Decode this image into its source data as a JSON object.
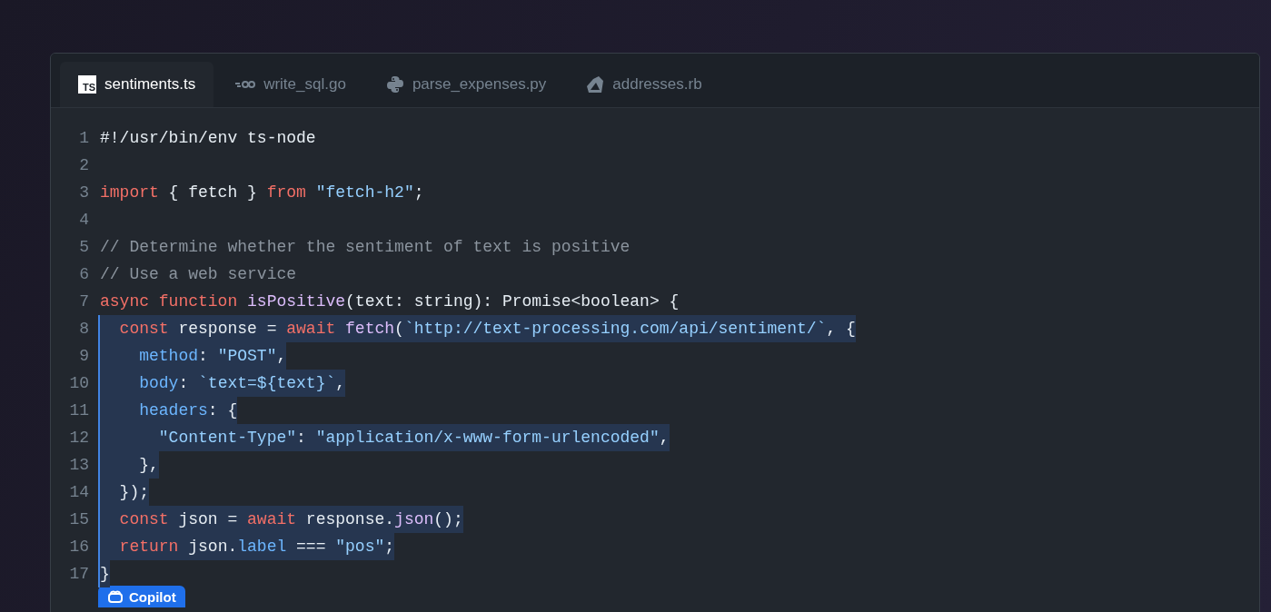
{
  "tabs": [
    {
      "label": "sentiments.ts",
      "kind": "ts",
      "icon_text": "TS",
      "selected": true
    },
    {
      "label": "write_sql.go",
      "kind": "go",
      "selected": false
    },
    {
      "label": "parse_expenses.py",
      "kind": "python",
      "selected": false
    },
    {
      "label": "addresses.rb",
      "kind": "ruby",
      "selected": false
    }
  ],
  "code": [
    {
      "number": "1",
      "suggested": false,
      "tokens": [
        {
          "kind": "plain",
          "text": "#!/usr/bin/env ts-node"
        }
      ]
    },
    {
      "number": "2",
      "suggested": false
    },
    {
      "number": "3",
      "suggested": false,
      "tokens": [
        {
          "kind": "keyword",
          "text": "import"
        },
        {
          "kind": "plain",
          "text": " { fetch } "
        },
        {
          "kind": "keyword",
          "text": "from"
        },
        {
          "kind": "string",
          "text": " \"fetch-h2\""
        },
        {
          "kind": "plain",
          "text": ";"
        }
      ]
    },
    {
      "number": "4",
      "suggested": false
    },
    {
      "number": "5",
      "suggested": false,
      "tokens": [
        {
          "kind": "comment",
          "text": "// Determine whether the sentiment of text is positive"
        }
      ]
    },
    {
      "number": "6",
      "suggested": false,
      "tokens": [
        {
          "kind": "comment",
          "text": "// Use a web service"
        }
      ]
    },
    {
      "number": "7",
      "suggested": false,
      "tokens": [
        {
          "kind": "keyword",
          "text": "async function"
        },
        {
          "kind": "function",
          "text": " isPositive"
        },
        {
          "kind": "plain",
          "text": "(text: string): Promise<boolean> {"
        }
      ]
    },
    {
      "number": "8",
      "suggested": true,
      "tokens": [
        {
          "kind": "keyword",
          "text": "  const"
        },
        {
          "kind": "plain",
          "text": " response = "
        },
        {
          "kind": "keyword",
          "text": "await"
        },
        {
          "kind": "function",
          "text": " fetch"
        },
        {
          "kind": "plain",
          "text": "("
        },
        {
          "kind": "string",
          "text": "`http://text-processing.com/api/sentiment/`"
        },
        {
          "kind": "plain",
          "text": ", {"
        }
      ]
    },
    {
      "number": "9",
      "suggested": true,
      "tokens": [
        {
          "kind": "property",
          "text": "    method"
        },
        {
          "kind": "plain",
          "text": ": "
        },
        {
          "kind": "string",
          "text": "\"POST\""
        },
        {
          "kind": "plain",
          "text": ","
        }
      ]
    },
    {
      "number": "10",
      "suggested": true,
      "tokens": [
        {
          "kind": "property",
          "text": "    body"
        },
        {
          "kind": "plain",
          "text": ": "
        },
        {
          "kind": "string",
          "text": "`text=${text}`"
        },
        {
          "kind": "plain",
          "text": ","
        }
      ]
    },
    {
      "number": "11",
      "suggested": true,
      "tokens": [
        {
          "kind": "property",
          "text": "    headers"
        },
        {
          "kind": "plain",
          "text": ": {"
        }
      ]
    },
    {
      "number": "12",
      "suggested": true,
      "tokens": [
        {
          "kind": "string",
          "text": "      \"Content-Type\""
        },
        {
          "kind": "plain",
          "text": ": "
        },
        {
          "kind": "string",
          "text": "\"application/x-www-form-urlencoded\""
        },
        {
          "kind": "plain",
          "text": ","
        }
      ]
    },
    {
      "number": "13",
      "suggested": true,
      "tokens": [
        {
          "kind": "plain",
          "text": "    },"
        }
      ]
    },
    {
      "number": "14",
      "suggested": true,
      "tokens": [
        {
          "kind": "plain",
          "text": "  });"
        }
      ]
    },
    {
      "number": "15",
      "suggested": true,
      "tokens": [
        {
          "kind": "keyword",
          "text": "  const"
        },
        {
          "kind": "plain",
          "text": " json = "
        },
        {
          "kind": "keyword",
          "text": "await"
        },
        {
          "kind": "plain",
          "text": " response."
        },
        {
          "kind": "function",
          "text": "json"
        },
        {
          "kind": "plain",
          "text": "();"
        }
      ]
    },
    {
      "number": "16",
      "suggested": true,
      "tokens": [
        {
          "kind": "keyword",
          "text": "  return"
        },
        {
          "kind": "plain",
          "text": " json."
        },
        {
          "kind": "property",
          "text": "label"
        },
        {
          "kind": "plain",
          "text": " === "
        },
        {
          "kind": "string",
          "text": "\"pos\""
        },
        {
          "kind": "plain",
          "text": ";"
        }
      ]
    },
    {
      "number": "17",
      "suggested": true,
      "tokens": [
        {
          "kind": "plain",
          "text": "}"
        }
      ]
    }
  ],
  "copilot_button": {
    "label": "Copilot"
  }
}
